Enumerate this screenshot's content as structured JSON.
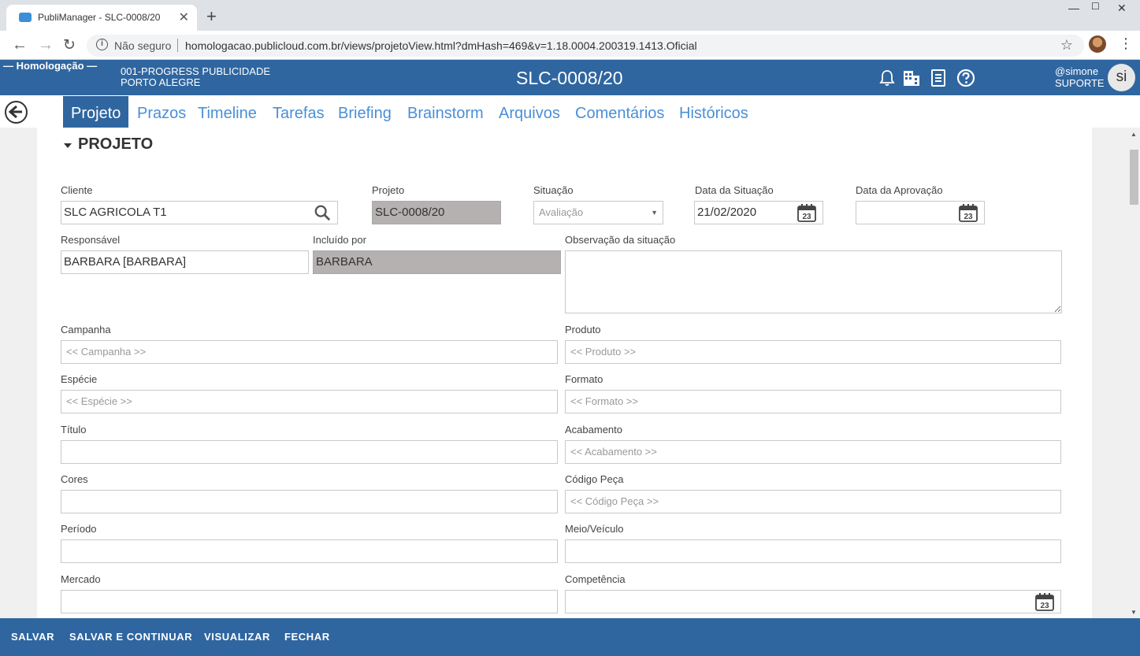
{
  "browser": {
    "tab_title": "PubliManager - SLC-0008/20",
    "security_label": "Não seguro",
    "url": "homologacao.publicloud.com.br/views/projetoView.html?dmHash=469&v=1.18.0004.200319.1413.Oficial"
  },
  "header": {
    "environment": "— Homologação —",
    "company_line1": "001-PROGRESS PUBLICIDADE",
    "company_line2": "PORTO ALEGRE",
    "document_code": "SLC-0008/20",
    "user_handle": "@simone",
    "user_role": "SUPORTE",
    "avatar_initials": "si"
  },
  "tabs": [
    {
      "label": "Projeto",
      "active": true
    },
    {
      "label": "Prazos"
    },
    {
      "label": "Timeline"
    },
    {
      "label": "Tarefas"
    },
    {
      "label": "Briefing"
    },
    {
      "label": "Brainstorm"
    },
    {
      "label": "Arquivos"
    },
    {
      "label": "Comentários"
    },
    {
      "label": "Históricos"
    }
  ],
  "section": {
    "title": "PROJETO"
  },
  "form": {
    "cliente": {
      "label": "Cliente",
      "value": "SLC AGRICOLA T1"
    },
    "projeto": {
      "label": "Projeto",
      "value": "SLC-0008/20"
    },
    "situacao": {
      "label": "Situação",
      "value": "Avaliação"
    },
    "data_situacao": {
      "label": "Data da Situação",
      "value": "21/02/2020"
    },
    "data_aprovacao": {
      "label": "Data da Aprovação",
      "value": ""
    },
    "responsavel": {
      "label": "Responsável",
      "value": "BARBARA [BARBARA]"
    },
    "incluido_por": {
      "label": "Incluído por",
      "value": "BARBARA"
    },
    "observacao": {
      "label": "Observação da situação",
      "value": ""
    },
    "campanha": {
      "label": "Campanha",
      "placeholder": "<< Campanha >>"
    },
    "produto": {
      "label": "Produto",
      "placeholder": "<< Produto >>"
    },
    "especie": {
      "label": "Espécie",
      "placeholder": "<< Espécie >>"
    },
    "formato": {
      "label": "Formato",
      "placeholder": "<< Formato >>"
    },
    "titulo": {
      "label": "Título",
      "value": ""
    },
    "acabamento": {
      "label": "Acabamento",
      "placeholder": "<< Acabamento >>"
    },
    "cores": {
      "label": "Cores",
      "value": ""
    },
    "codigo_peca": {
      "label": "Código Peça",
      "placeholder": "<< Código Peça >>"
    },
    "periodo": {
      "label": "Período",
      "value": ""
    },
    "meio_veiculo": {
      "label": "Meio/Veículo",
      "value": ""
    },
    "mercado": {
      "label": "Mercado",
      "value": ""
    },
    "competencia": {
      "label": "Competência",
      "value": ""
    },
    "calendar_day": "23"
  },
  "footer": {
    "save": "SALVAR",
    "save_continue": "SALVAR E CONTINUAR",
    "view": "VISUALIZAR",
    "close": "FECHAR"
  },
  "colors": {
    "primary": "#2f66a0",
    "tab_link": "#4a8fd6",
    "readonly_bg": "#b5b1b1"
  }
}
